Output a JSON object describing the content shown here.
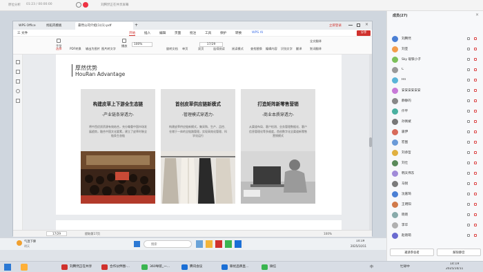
{
  "top_bar": {
    "app_text": "原位分析",
    "record_time": "01:23 / 00:00:00",
    "meeting_title": "刘腾然正在共享屏幕",
    "call_label": "正在讲话:",
    "speaker": "刘腾然"
  },
  "wps": {
    "tabs": [
      "WPS Office",
      "找稻壳模板",
      "豪然公司介绍(1)(1).pdf"
    ],
    "login_label": "立即登录",
    "menu": [
      "三 文件",
      "开始",
      "插入",
      "编辑",
      "页面",
      "批注",
      "工具",
      "保护",
      "转换",
      "WPS AI"
    ],
    "active_menu": "开始",
    "share_label": "分享",
    "toolbar": [
      "手型",
      "选择",
      "PDF转换",
      "输出为图片",
      "图片转文字",
      "播放",
      "旋转文档",
      "单页",
      "双页",
      "连续阅读",
      "阅读模式",
      "查找替换",
      "编辑内容",
      "识别文字",
      "翻译",
      "全文翻译",
      "划词翻译"
    ],
    "zoom": "100%",
    "page_number": "17/29",
    "page_label": "17/29",
    "page_count_label": "提取第17页"
  },
  "slide": {
    "title_cn": "厚然优势",
    "title_en": "HouRan Advantage",
    "cards": [
      {
        "heading": "构建皮草上下游全生态链",
        "sub": "-产业链条穿透力-",
        "desc": "将中西优质资源有效结合，充分尊重中国市场发展趋势，融合中国文化要素，建立了皮草时装全链条生态链"
      },
      {
        "heading": "首创皮草供应链新模式",
        "sub": "-管理模式穿透力-",
        "desc": "构建皮草供应链新模式，集采购、生产、品控、仓储于一体的全链路管理，实现高效化管理、科学化运行"
      },
      {
        "heading": "打造矩阵新零售营销",
        "sub": "-商业本质穿透力-",
        "desc": "从渠道布局、客户检测、业务管理数据化、客户信息管理化等多维度，首创数字化全渠道新零售营销模式"
      }
    ]
  },
  "participants_panel": {
    "header": "成员(27)",
    "names": [
      "刘腾然",
      "刘亚",
      "Sky 吸铁小子",
      "C",
      "Hn",
      "安安安安安安",
      "静静的",
      "仟平",
      "孙佩斌",
      "骏伊",
      "宏图",
      "刘承哲",
      "刘仕",
      "韩天伟东",
      "马锐",
      "沈嘉琦",
      "王明阳",
      "晓晓",
      "李华",
      "赵晓萌"
    ],
    "btn_invite": "邀请参会者",
    "btn_manage": "解除静音"
  },
  "remote_taskbar": {
    "weather": "气温下降",
    "weather_sub": "明天",
    "search": "搜索",
    "time": "14:19",
    "date": "2025/10/11"
  },
  "taskbar": {
    "apps": [
      "刘腾然正在共享",
      "合作伙伴圈-...",
      "360导航_一...",
      "腾讯会议",
      "聊优品牌直...",
      "微信"
    ],
    "ime": "中",
    "tray_label": "忙碌中",
    "time": "14:19",
    "date": "2025/10/11"
  }
}
